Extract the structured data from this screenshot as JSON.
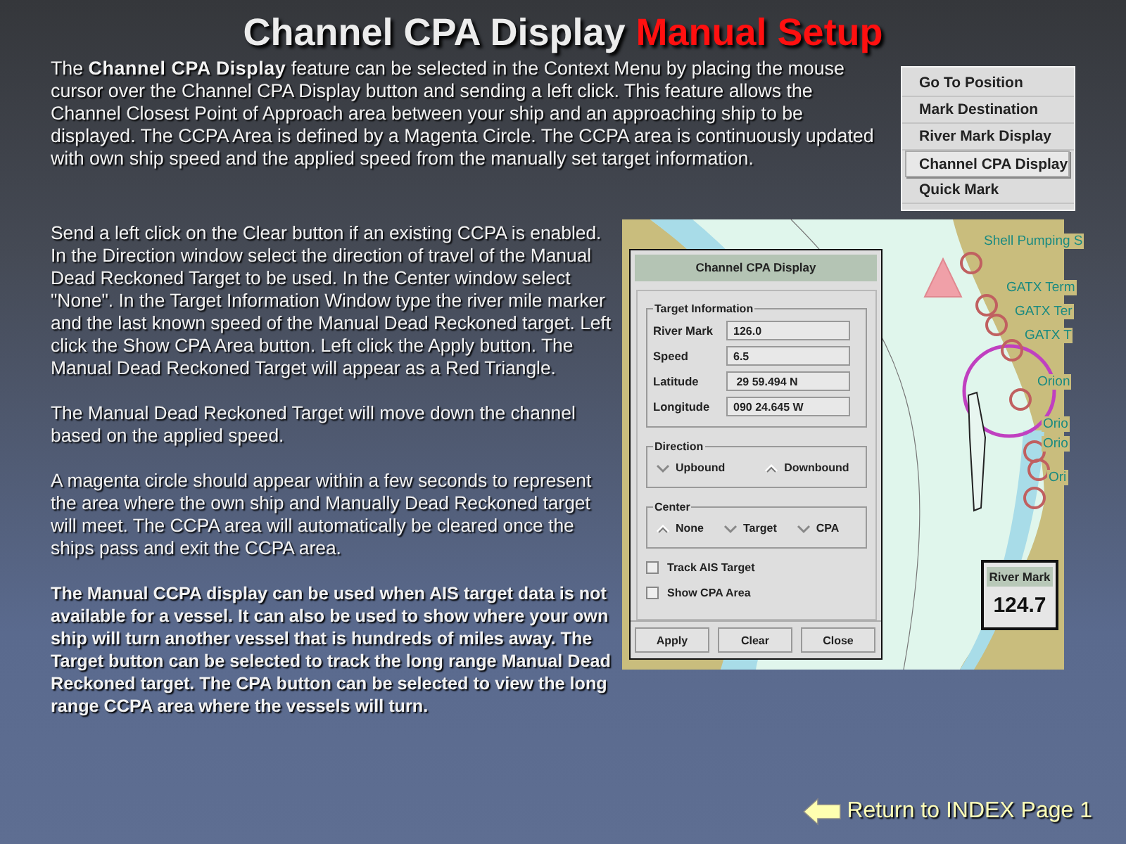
{
  "title": {
    "main": "Channel CPA Display",
    "highlight": "Manual Setup"
  },
  "intro": "The **Channel CPA Display** feature can be selected in the Context Menu by placing the  mouse cursor over the Channel CPA Display button and sending a left click. This feature allows the Channel Closest Point of Approach area between your ship and an approaching ship to be displayed.  The CCPA Area is defined by a Magenta Circle.  The CCPA area is continuously updated with own ship speed and the applied speed from the manually set target information.",
  "context_menu": {
    "items": [
      {
        "label": "Go To Position",
        "selected": false
      },
      {
        "label": "Mark Destination",
        "selected": false
      },
      {
        "label": "River Mark Display",
        "selected": false
      },
      {
        "label": "Channel CPA Display",
        "selected": true
      },
      {
        "label": "Quick Mark",
        "selected": false
      }
    ]
  },
  "paragraphs": [
    {
      "kind": "normal",
      "text": "Send a left click on the Clear button if an existing CCPA is enabled.  In the Direction window select the direction of  travel of the Manual Dead Reckoned Target to be used.  In the Center window select \"None\".   In the Target Information Window type the river mile marker and the last known speed of the Manual Dead Reckoned target. Left click the Show CPA Area button.  Left click the Apply button.  The Manual Dead Reckoned Target will appear as a Red Triangle."
    },
    {
      "kind": "normal",
      "text": "The Manual Dead Reckoned Target will move down the channel based on the applied speed."
    },
    {
      "kind": "normal",
      "text": "A magenta circle should appear within a few seconds to represent the area where the own ship and Manually Dead Reckoned  target will meet.   The CCPA area will automatically be cleared once the ships pass and exit the CCPA area."
    },
    {
      "kind": "bold",
      "text": "The Manual CCPA display can be used when AIS target data is not available for a vessel.  It can also be used to show where your own ship will turn another vessel that is hundreds of miles away.  The Target button can be selected to track the long range Manual Dead Reckoned target.  The CPA button can be selected to view the long range CCPA area where the vessels will turn."
    }
  ],
  "map": {
    "labels": [
      "Shell Pumping S",
      "GATX Term",
      "GATX Ter",
      "GATX T",
      "Orion",
      "Orio",
      "Orio",
      "Ori"
    ],
    "river_mark": {
      "label": "River Mark",
      "value": "124.7"
    }
  },
  "dialog": {
    "title": "Channel CPA Display",
    "target_information": {
      "title": "Target Information",
      "fields": [
        {
          "label": "River Mark",
          "value": "126.0"
        },
        {
          "label": "Speed",
          "value": "6.5"
        },
        {
          "label": "Latitude",
          "value": " 29 59.494 N"
        },
        {
          "label": "Longitude",
          "value": "090 24.645 W"
        }
      ]
    },
    "direction": {
      "title": "Direction",
      "options": [
        {
          "label": "Upbound",
          "selected": false
        },
        {
          "label": "Downbound",
          "selected": true
        }
      ]
    },
    "center": {
      "title": "Center",
      "options": [
        {
          "label": "None",
          "selected": true
        },
        {
          "label": "Target",
          "selected": false
        },
        {
          "label": "CPA",
          "selected": false
        }
      ]
    },
    "checkboxes": [
      {
        "label": "Track AIS Target",
        "checked": false
      },
      {
        "label": "Show CPA Area",
        "checked": false
      }
    ],
    "buttons": [
      "Apply",
      "Clear",
      "Close"
    ]
  },
  "footer": {
    "link": "Return to INDEX Page 1"
  }
}
